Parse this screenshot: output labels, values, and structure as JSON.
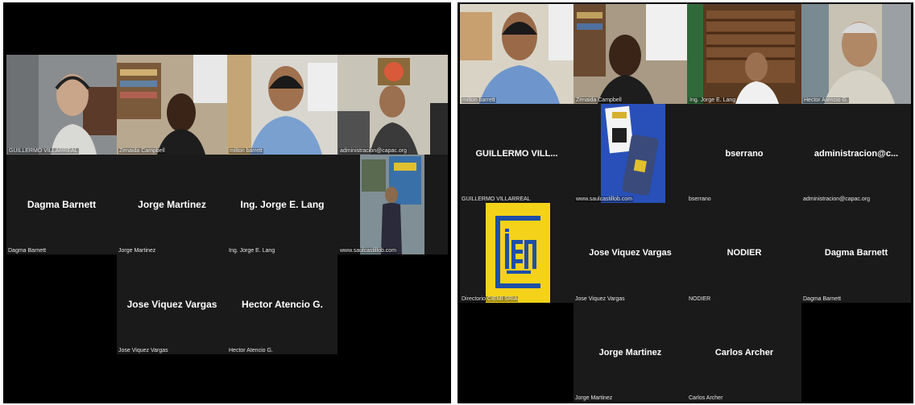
{
  "left_panel": {
    "video_tiles": [
      {
        "label": "GUILLERMO VILLARREAL"
      },
      {
        "label": "Zenaida Campbell"
      },
      {
        "label": "milton barrett"
      },
      {
        "label": "administracion@capac.org"
      },
      {
        "label": "www.saulcastillob.com"
      }
    ],
    "name_tiles": [
      {
        "name": "Dagma Barnett",
        "label": "Dagma Barnett"
      },
      {
        "name": "Jorge Martinez",
        "label": "Jorge Martinez"
      },
      {
        "name": "Ing. Jorge E. Lang",
        "label": "Ing. Jorge E. Lang"
      },
      {
        "name": "Jose Viquez Vargas",
        "label": "Jose Viquez Vargas"
      },
      {
        "name": "Hector Atencio G.",
        "label": "Hector Atencio G."
      }
    ]
  },
  "right_panel": {
    "video_tiles": [
      {
        "label": "milton barrett"
      },
      {
        "label": "Zenaida Campbell"
      },
      {
        "label": "Ing. Jorge E. Lang"
      },
      {
        "label": "Hector Atencio G."
      },
      {
        "label": "www.saulcastillob.com"
      }
    ],
    "name_tiles": [
      {
        "name": "GUILLERMO VILL...",
        "label": "GUILLERMO VILLARREAL"
      },
      {
        "name": "bserrano",
        "label": "bserrano"
      },
      {
        "name": "administracion@c...",
        "label": "administracion@capac.org"
      },
      {
        "name": "Jose Viquez Vargas",
        "label": "Jose Viquez Vargas"
      },
      {
        "name": "NODIER",
        "label": "NODIER"
      },
      {
        "name": "Dagma Barnett",
        "label": "Dagma Barnett"
      },
      {
        "name": "Jorge Martinez",
        "label": "Jorge Martinez"
      },
      {
        "name": "Carlos Archer",
        "label": "Carlos Archer"
      }
    ],
    "logo_tile": {
      "logo_text": "CIEMI",
      "label": "Directorio CIEMI SRIA"
    }
  }
}
